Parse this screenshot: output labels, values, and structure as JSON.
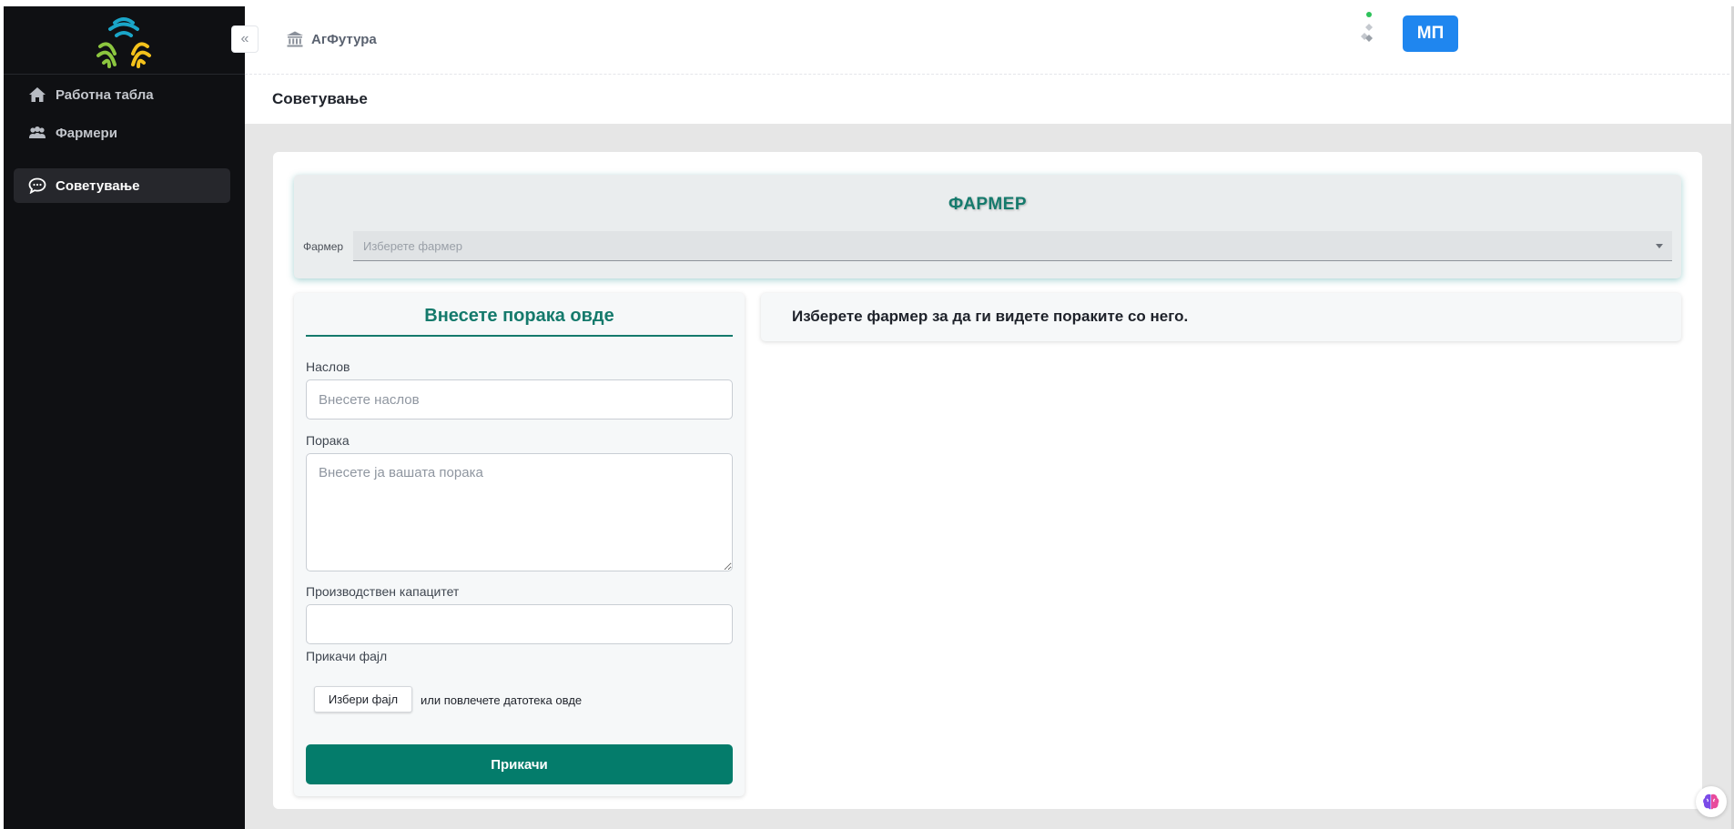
{
  "app": {
    "brand_label": "АгФутура",
    "avatar_initials": "МП",
    "accent_color": "#157a6c",
    "primary_button_color": "#047c6b",
    "avatar_color": "#1f86ef"
  },
  "sidebar": {
    "items": [
      {
        "label": "Работна табла",
        "icon": "home-icon",
        "active": false
      },
      {
        "label": "Фармери",
        "icon": "users-icon",
        "active": false
      },
      {
        "label": "Советување",
        "icon": "chat-icon",
        "active": true
      }
    ]
  },
  "page": {
    "title": "Советување"
  },
  "farmer_panel": {
    "heading": "ФАРМЕР",
    "field_label": "Фармер",
    "select_placeholder": "Изберете фармер"
  },
  "message_form": {
    "heading": "Внесете порака овде",
    "title_label": "Наслов",
    "title_placeholder": "Внесете наслов",
    "message_label": "Порака",
    "message_placeholder": "Внесете ја вашата порака",
    "capacity_label": "Производствен капацитет",
    "capacity_value": "",
    "attach_label": "Прикачи фајл",
    "file_button_label": "Избери фајл",
    "file_hint": "или повлечете датотека овде",
    "submit_label": "Прикачи"
  },
  "messages": {
    "empty_text": "Изберете фармер за да ги видете пораките со него."
  }
}
